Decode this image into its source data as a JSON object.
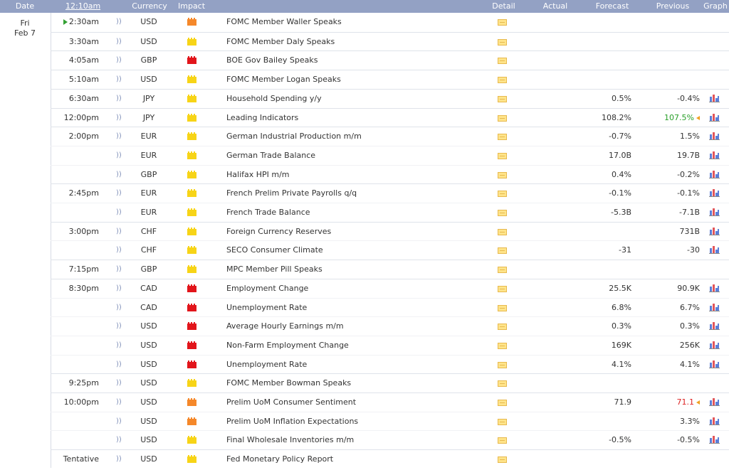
{
  "header": {
    "date": "Date",
    "time": "12:10am",
    "currency": "Currency",
    "impact": "Impact",
    "detail": "Detail",
    "actual": "Actual",
    "forecast": "Forecast",
    "previous": "Previous",
    "graph": "Graph"
  },
  "day": {
    "weekday": "Fri",
    "date": "Feb 7"
  },
  "colors": {
    "header_bg": "#93a1c4",
    "high_impact": "#e2151b",
    "medium_impact": "#f5882a",
    "low_impact": "#f7d417",
    "better": "#2aa02a",
    "worse": "#dd2222"
  },
  "events": [
    {
      "time": "2:30am",
      "currency": "USD",
      "impact": "orange",
      "event": "FOMC Member Waller Speaks",
      "actual": "",
      "forecast": "",
      "previous": "",
      "graph": false,
      "current": true
    },
    {
      "time": "3:30am",
      "currency": "USD",
      "impact": "yellow",
      "event": "FOMC Member Daly Speaks",
      "actual": "",
      "forecast": "",
      "previous": "",
      "graph": false
    },
    {
      "time": "4:05am",
      "currency": "GBP",
      "impact": "red",
      "event": "BOE Gov Bailey Speaks",
      "actual": "",
      "forecast": "",
      "previous": "",
      "graph": false
    },
    {
      "time": "5:10am",
      "currency": "USD",
      "impact": "yellow",
      "event": "FOMC Member Logan Speaks",
      "actual": "",
      "forecast": "",
      "previous": "",
      "graph": false
    },
    {
      "time": "6:30am",
      "currency": "JPY",
      "impact": "yellow",
      "event": "Household Spending y/y",
      "actual": "",
      "forecast": "0.5%",
      "previous": "-0.4%",
      "graph": true
    },
    {
      "time": "12:00pm",
      "currency": "JPY",
      "impact": "yellow",
      "event": "Leading Indicators",
      "actual": "",
      "forecast": "108.2%",
      "previous": "107.5%",
      "prev_style": "better",
      "revised": true,
      "graph": true
    },
    {
      "time": "2:00pm",
      "currency": "EUR",
      "impact": "yellow",
      "event": "German Industrial Production m/m",
      "actual": "",
      "forecast": "-0.7%",
      "previous": "1.5%",
      "graph": true
    },
    {
      "time": "",
      "currency": "EUR",
      "impact": "yellow",
      "event": "German Trade Balance",
      "actual": "",
      "forecast": "17.0B",
      "previous": "19.7B",
      "graph": true
    },
    {
      "time": "",
      "currency": "GBP",
      "impact": "yellow",
      "event": "Halifax HPI m/m",
      "actual": "",
      "forecast": "0.4%",
      "previous": "-0.2%",
      "graph": true
    },
    {
      "time": "2:45pm",
      "currency": "EUR",
      "impact": "yellow",
      "event": "French Prelim Private Payrolls q/q",
      "actual": "",
      "forecast": "-0.1%",
      "previous": "-0.1%",
      "graph": true
    },
    {
      "time": "",
      "currency": "EUR",
      "impact": "yellow",
      "event": "French Trade Balance",
      "actual": "",
      "forecast": "-5.3B",
      "previous": "-7.1B",
      "graph": true
    },
    {
      "time": "3:00pm",
      "currency": "CHF",
      "impact": "yellow",
      "event": "Foreign Currency Reserves",
      "actual": "",
      "forecast": "",
      "previous": "731B",
      "graph": true
    },
    {
      "time": "",
      "currency": "CHF",
      "impact": "yellow",
      "event": "SECO Consumer Climate",
      "actual": "",
      "forecast": "-31",
      "previous": "-30",
      "graph": true
    },
    {
      "time": "7:15pm",
      "currency": "GBP",
      "impact": "yellow",
      "event": "MPC Member Pill Speaks",
      "actual": "",
      "forecast": "",
      "previous": "",
      "graph": false
    },
    {
      "time": "8:30pm",
      "currency": "CAD",
      "impact": "red",
      "event": "Employment Change",
      "actual": "",
      "forecast": "25.5K",
      "previous": "90.9K",
      "graph": true
    },
    {
      "time": "",
      "currency": "CAD",
      "impact": "red",
      "event": "Unemployment Rate",
      "actual": "",
      "forecast": "6.8%",
      "previous": "6.7%",
      "graph": true
    },
    {
      "time": "",
      "currency": "USD",
      "impact": "red",
      "event": "Average Hourly Earnings m/m",
      "actual": "",
      "forecast": "0.3%",
      "previous": "0.3%",
      "graph": true
    },
    {
      "time": "",
      "currency": "USD",
      "impact": "red",
      "event": "Non-Farm Employment Change",
      "actual": "",
      "forecast": "169K",
      "previous": "256K",
      "graph": true
    },
    {
      "time": "",
      "currency": "USD",
      "impact": "red",
      "event": "Unemployment Rate",
      "actual": "",
      "forecast": "4.1%",
      "previous": "4.1%",
      "graph": true
    },
    {
      "time": "9:25pm",
      "currency": "USD",
      "impact": "yellow",
      "event": "FOMC Member Bowman Speaks",
      "actual": "",
      "forecast": "",
      "previous": "",
      "graph": false
    },
    {
      "time": "10:00pm",
      "currency": "USD",
      "impact": "orange",
      "event": "Prelim UoM Consumer Sentiment",
      "actual": "",
      "forecast": "71.9",
      "previous": "71.1",
      "prev_style": "worse",
      "revised": true,
      "graph": true
    },
    {
      "time": "",
      "currency": "USD",
      "impact": "orange",
      "event": "Prelim UoM Inflation Expectations",
      "actual": "",
      "forecast": "",
      "previous": "3.3%",
      "graph": true
    },
    {
      "time": "",
      "currency": "USD",
      "impact": "yellow",
      "event": "Final Wholesale Inventories m/m",
      "actual": "",
      "forecast": "-0.5%",
      "previous": "-0.5%",
      "graph": true
    },
    {
      "time": "Tentative",
      "currency": "USD",
      "impact": "yellow",
      "event": "Fed Monetary Policy Report",
      "actual": "",
      "forecast": "",
      "previous": "",
      "graph": false
    }
  ]
}
